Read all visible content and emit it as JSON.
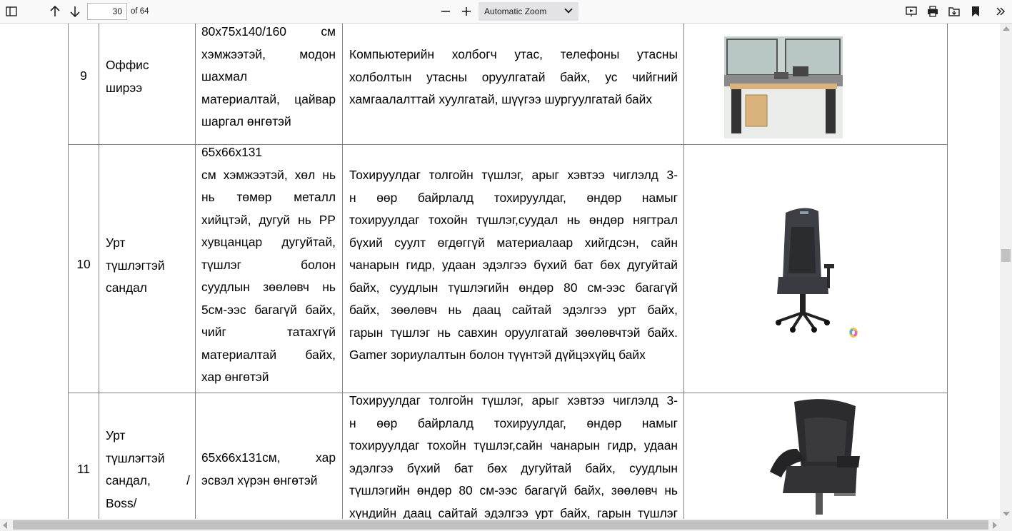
{
  "toolbar": {
    "page_current": "30",
    "page_of": "of 64",
    "zoom_label": "Automatic Zoom"
  },
  "rows": [
    {
      "num": "9",
      "name_lines": [
        "Оффис",
        "ширээ"
      ],
      "dims_lines": [
        "80x75x140/160 см",
        "хэмжээтэй, модон",
        "шахмал",
        "материалтай, цайвар",
        "шаргал өнгөтэй"
      ],
      "desc_lines": [
        "Компьютерийн холбогч утас, телефоны утасны",
        "холболтын утасны оруулгатай байх, ус чийгний",
        "хамгаалалттай хуулгатай, шүүгээ шургуулгатай байх"
      ],
      "image": "office-desk-image"
    },
    {
      "num": "10",
      "name_lines": [
        "Урт",
        "түшлэгтэй",
        "сандал"
      ],
      "dims_lines": [
        "65x66x131",
        "см хэмжээтэй, хөл нь",
        "нь төмөр металл",
        "хийцтэй, дугуй нь PP",
        "хувцанцар дугуйтай,",
        "түшлэг болон",
        "суудлын зөөлөвч нь",
        "5см-ээс багагүй байх,",
        "чийг татахгүй",
        "материалтай байх,",
        "хар өнгөтэй"
      ],
      "desc_lines": [
        "Тохируулдаг толгойн түшлэг,  арыг хэвтээ чиглэлд 3-",
        "н өөр байрлалд тохируулдаг, өндөр намыг",
        "тохируулдаг тохойн түшлэг,суудал нь  өндөр нягтрал",
        "бүхий суулт өгдөггүй материалаар хийгдсэн, сайн",
        "чанарын гидр, удаан эдэлгээ бүхий бат бөх дугуйтай",
        "байх, суудлын түшлэгийн өндөр 80 см-ээс багагүй",
        "байх, зөөлөвч нь даац сайтай эдэлгээ урт байх,",
        "гарын түшлэг нь савхин оруулгатай зөөлөвчтэй байх.",
        "Gamer зориулалтын болон түүнтэй дүйцэхүйц байх"
      ],
      "image": "gamer-chair-image"
    },
    {
      "num": "11",
      "name_lines": [
        "Урт",
        "түшлэгтэй",
        "сандал, /",
        "Boss/"
      ],
      "dims_lines": [
        "65x66x131см, хар",
        "эсвэл хүрэн өнгөтэй"
      ],
      "desc_lines": [
        "Тохируулдаг толгойн түшлэг,  арыг хэвтээ чиглэлд 3-",
        "н өөр байрлалд тохируулдаг, өндөр намыг",
        "тохируулдаг тохойн түшлэг,сайн чанарын гидр, удаан",
        "эдэлгээ бүхий бат бөх дугуйтай байх, суудлын",
        "түшлэгийн өндөр 80 см-ээс багагүй байх, зөөлөвч нь",
        "хүндийн даац сайтай эдэлгээ урт байх, гарын түшлэг"
      ],
      "image": "boss-chair-image"
    }
  ]
}
